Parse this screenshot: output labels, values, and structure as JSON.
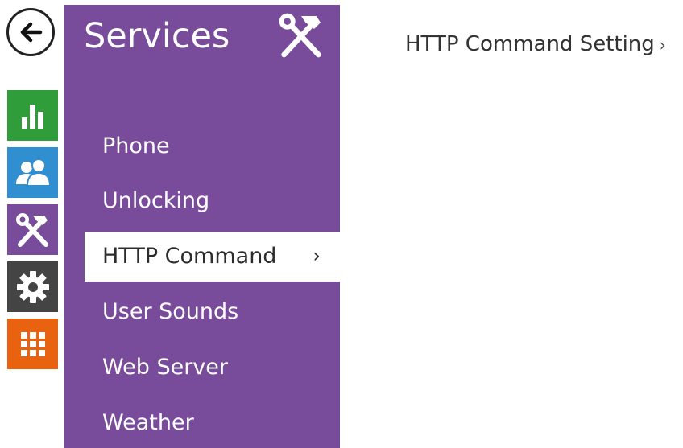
{
  "colors": {
    "menu_panel": "#784b9b",
    "status_tile": "#2f9e3a",
    "directory_tile": "#2f8fd0",
    "services_tile": "#784b9b",
    "hardware_tile": "#444444",
    "system_tile": "#e8620f"
  },
  "nav": {
    "back_icon": "arrow-left-icon",
    "rail": [
      {
        "id": "status",
        "icon": "bar-chart-icon"
      },
      {
        "id": "directory",
        "icon": "users-icon"
      },
      {
        "id": "services",
        "icon": "tools-icon"
      },
      {
        "id": "hardware",
        "icon": "gear-icon"
      },
      {
        "id": "system",
        "icon": "grid-icon"
      }
    ]
  },
  "menu": {
    "title": "Services",
    "title_icon": "tools-icon",
    "items": [
      {
        "label": "Phone"
      },
      {
        "label": "Unlocking"
      },
      {
        "label": "HTTP Command",
        "active": true,
        "chevron": "›"
      },
      {
        "label": "User Sounds"
      },
      {
        "label": "Web Server"
      },
      {
        "label": "Weather"
      }
    ]
  },
  "breadcrumb": {
    "label": "HTTP Command Setting",
    "chevron": "›"
  }
}
